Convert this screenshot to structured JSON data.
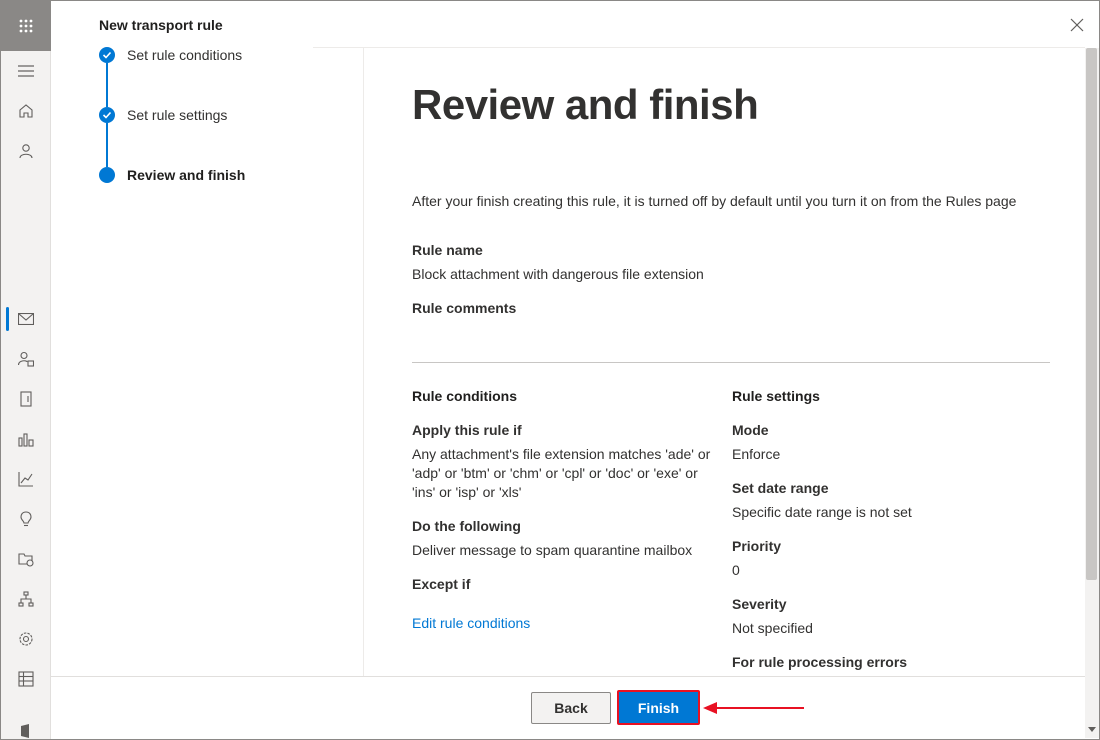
{
  "panel": {
    "title": "New transport rule",
    "close_label": "×"
  },
  "steps": [
    {
      "label": "Set rule conditions",
      "state": "completed"
    },
    {
      "label": "Set rule settings",
      "state": "completed"
    },
    {
      "label": "Review and finish",
      "state": "current"
    }
  ],
  "main": {
    "heading": "Review and finish",
    "intro": "After your finish creating this rule, it is turned off by default until you turn it on from the Rules page",
    "rule_name_label": "Rule name",
    "rule_name_value": "Block attachment with dangerous file extension",
    "rule_comments_label": "Rule comments"
  },
  "conditions": {
    "title": "Rule conditions",
    "apply_label": "Apply this rule if",
    "apply_lines": [
      "Any attachment's file extension matches 'ade' or",
      "'adp' or 'btm' or 'chm' or 'cpl' or 'doc' or 'exe' or",
      "'ins' or 'isp' or 'xls'"
    ],
    "do_label": "Do the following",
    "do_value": "Deliver message to spam quarantine mailbox",
    "except_label": "Except if",
    "edit_link": "Edit rule conditions"
  },
  "settings": {
    "title": "Rule settings",
    "mode_label": "Mode",
    "mode_value": "Enforce",
    "date_label": "Set date range",
    "date_value": "Specific date range is not set",
    "priority_label": "Priority",
    "priority_value": "0",
    "severity_label": "Severity",
    "severity_value": "Not specified",
    "errors_label": "For rule processing errors"
  },
  "footer": {
    "back_label": "Back",
    "finish_label": "Finish"
  },
  "colors": {
    "accent": "#0078d4",
    "highlight": "#e81123"
  },
  "rail_icons": [
    "waffle-icon",
    "menu-icon",
    "home-icon",
    "user-icon",
    "mail-icon",
    "user-lock-icon",
    "mobile-icon",
    "reports-icon",
    "chart-icon",
    "lightbulb-icon",
    "folder-globe-icon",
    "org-chart-icon",
    "settings-icon",
    "table-icon",
    "office-icon"
  ]
}
